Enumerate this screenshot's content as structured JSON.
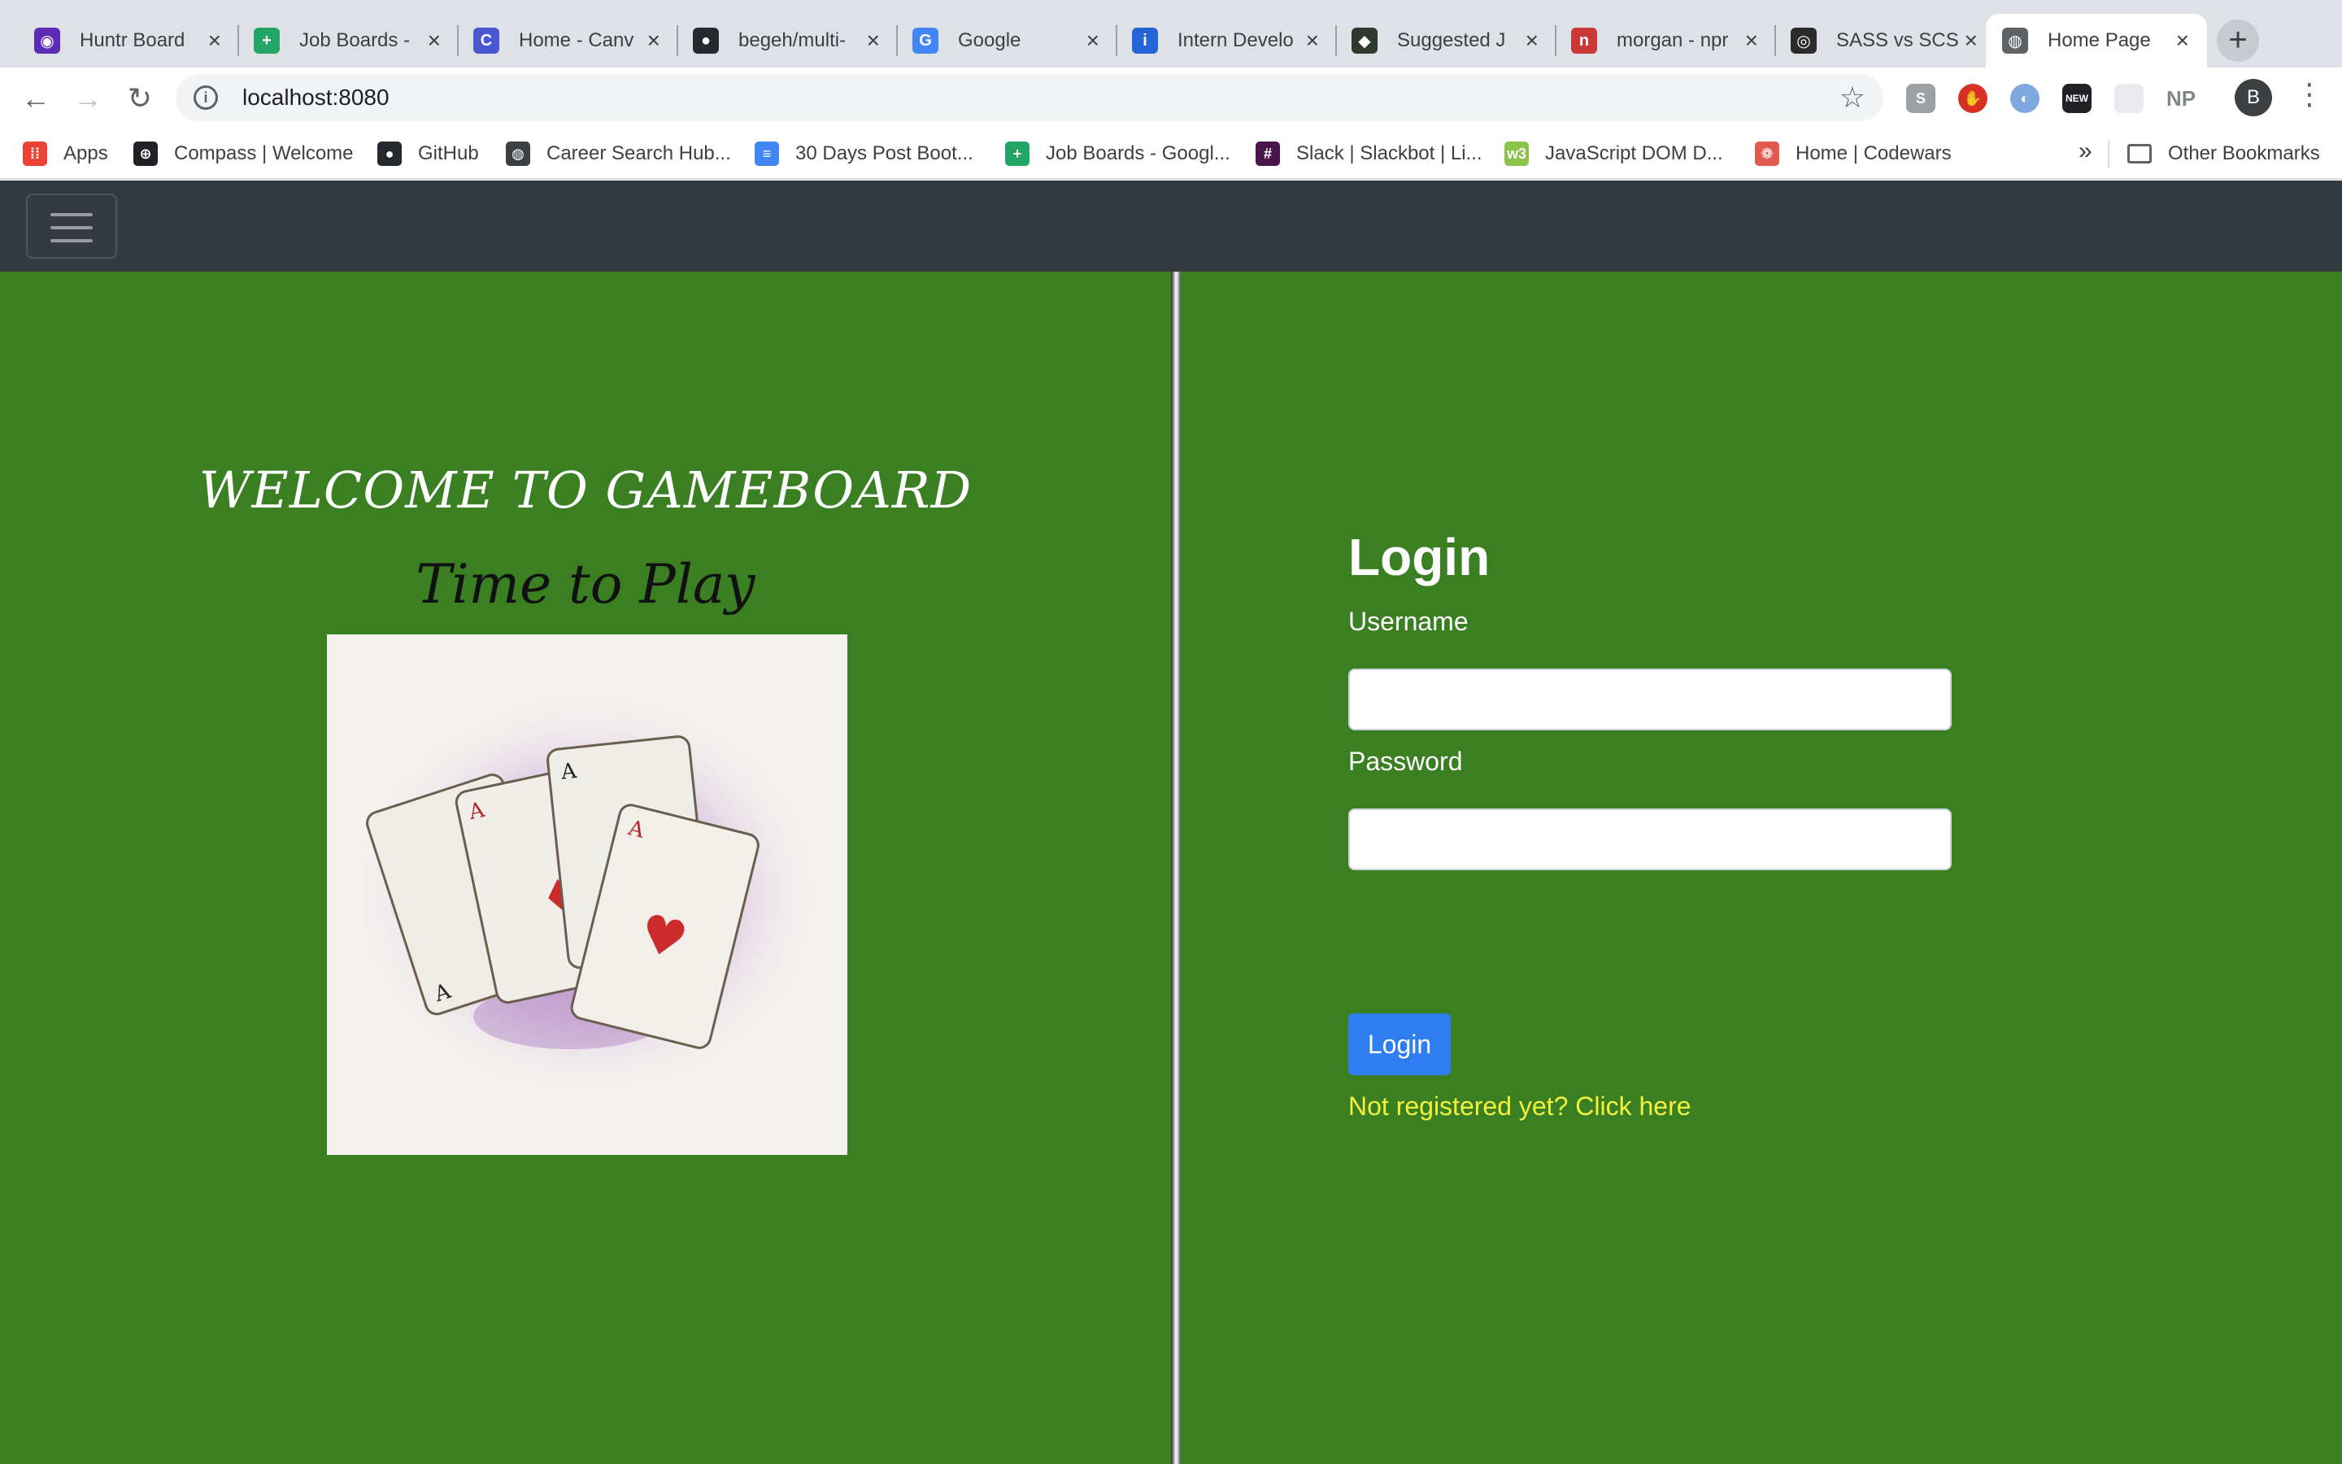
{
  "tabs": [
    {
      "title": "Huntr Board",
      "icon": "huntr-icon",
      "color": "#5b2bb5"
    },
    {
      "title": "Job Boards -",
      "icon": "sheets-icon",
      "color": "#23a566"
    },
    {
      "title": "Home - Canv",
      "icon": "canvas-icon",
      "color": "#4a57d0"
    },
    {
      "title": "begeh/multi-",
      "icon": "github-icon",
      "color": "#24292e"
    },
    {
      "title": "Google",
      "icon": "google-icon",
      "color": "#4285f4"
    },
    {
      "title": "Intern Develo",
      "icon": "info-icon",
      "color": "#2464d6"
    },
    {
      "title": "Suggested J",
      "icon": "suggested-icon",
      "color": "#2f3a2f"
    },
    {
      "title": "morgan - npr",
      "icon": "npm-icon",
      "color": "#cb3837"
    },
    {
      "title": "SASS vs SCS",
      "icon": "sass-icon",
      "color": "#2b2b2b"
    },
    {
      "title": "Home Page",
      "icon": "globe-icon",
      "color": "#5f6368"
    }
  ],
  "address": {
    "url": "localhost:8080"
  },
  "bookmarks": [
    {
      "label": "Apps",
      "icon": "apps-grid-icon",
      "color": "#ea4335"
    },
    {
      "label": "Compass | Welcome",
      "icon": "compass-icon",
      "color": "#202124"
    },
    {
      "label": "GitHub",
      "icon": "github-icon",
      "color": "#24292e"
    },
    {
      "label": "Career Search Hub...",
      "icon": "globe-icon",
      "color": "#3c4043"
    },
    {
      "label": "30 Days Post Boot...",
      "icon": "docs-icon",
      "color": "#4285f4"
    },
    {
      "label": "Job Boards - Googl...",
      "icon": "sheets-icon",
      "color": "#23a566"
    },
    {
      "label": "Slack | Slackbot | Li...",
      "icon": "slack-icon",
      "color": "#4a154b"
    },
    {
      "label": "JavaScript DOM D...",
      "icon": "w3-icon",
      "color": "#8bc34a"
    },
    {
      "label": "Home | Codewars",
      "icon": "codewars-icon",
      "color": "#e05a4f"
    }
  ],
  "other_bookmarks": "Other Bookmarks",
  "more_bookmarks": "»",
  "profile_initial": "B",
  "page": {
    "welcome": "WELCOME TO GAMEBOARD",
    "tagline": "Time to Play",
    "login_title": "Login",
    "username_label": "Username",
    "password_label": "Password",
    "login_button": "Login",
    "register_link": "Not registered yet? Click here",
    "colors": {
      "background": "#3a7f22",
      "navbar": "#343a40",
      "button": "#2f7ef1",
      "link": "#f2f23c"
    }
  }
}
